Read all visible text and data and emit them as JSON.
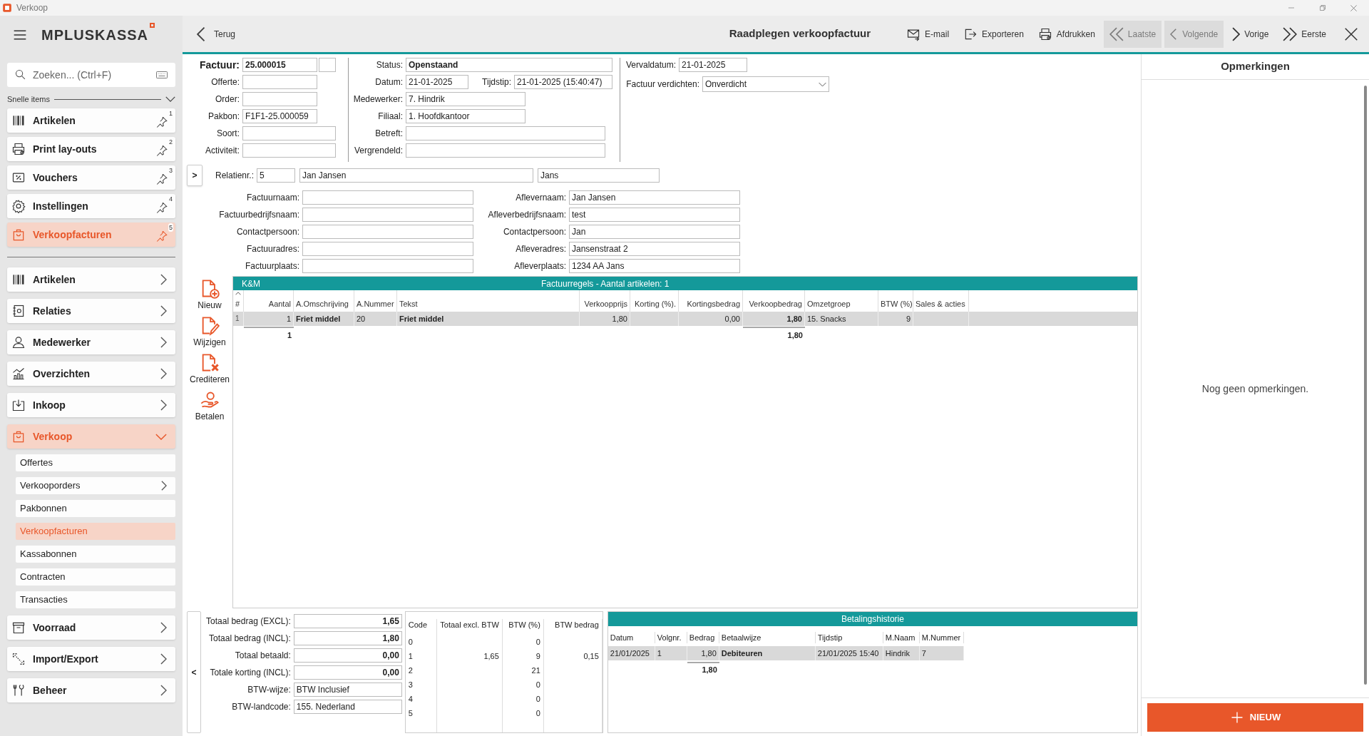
{
  "window": {
    "title": "Verkoop"
  },
  "app": {
    "logo": "MPLUSKASSA"
  },
  "search": {
    "placeholder": "Zoeken... (Ctrl+F)"
  },
  "quick_items": {
    "label": "Snelle items",
    "expanded": true,
    "items": [
      {
        "label": "Artikelen",
        "pin": "1",
        "selected": false
      },
      {
        "label": "Print lay-outs",
        "pin": "2",
        "selected": false
      },
      {
        "label": "Vouchers",
        "pin": "3",
        "selected": false
      },
      {
        "label": "Instellingen",
        "pin": "4",
        "selected": false
      },
      {
        "label": "Verkoopfacturen",
        "pin": "5",
        "selected": true
      }
    ]
  },
  "nav": [
    {
      "label": "Artikelen",
      "expanded": false,
      "selected": false
    },
    {
      "label": "Relaties",
      "expanded": false,
      "selected": false
    },
    {
      "label": "Medewerker",
      "expanded": false,
      "selected": false
    },
    {
      "label": "Overzichten",
      "expanded": false,
      "selected": false
    },
    {
      "label": "Inkoop",
      "expanded": false,
      "selected": false
    },
    {
      "label": "Verkoop",
      "expanded": true,
      "selected": true,
      "children": [
        {
          "label": "Offertes",
          "expandable": false,
          "selected": false
        },
        {
          "label": "Verkooporders",
          "expandable": true,
          "selected": false
        },
        {
          "label": "Pakbonnen",
          "expandable": false,
          "selected": false
        },
        {
          "label": "Verkoopfacturen",
          "expandable": false,
          "selected": true
        },
        {
          "label": "Kassabonnen",
          "expandable": false,
          "selected": false
        },
        {
          "label": "Contracten",
          "expandable": false,
          "selected": false
        },
        {
          "label": "Transacties",
          "expandable": false,
          "selected": false
        }
      ]
    },
    {
      "label": "Voorraad",
      "expanded": false,
      "selected": false
    },
    {
      "label": "Import/Export",
      "expanded": false,
      "selected": false
    },
    {
      "label": "Beheer",
      "expanded": false,
      "selected": false
    }
  ],
  "header": {
    "back": "Terug",
    "title": "Raadplegen verkoopfactuur",
    "actions": [
      {
        "label": "E-mail",
        "disabled": false
      },
      {
        "label": "Exporteren",
        "disabled": false
      },
      {
        "label": "Afdrukken",
        "disabled": false
      },
      {
        "label": "Laatste",
        "disabled": true
      },
      {
        "label": "Volgende",
        "disabled": true
      },
      {
        "label": "Vorige",
        "disabled": false
      },
      {
        "label": "Eerste",
        "disabled": false
      }
    ]
  },
  "document": {
    "left": [
      {
        "label": "Factuur:",
        "value": "25.000015"
      },
      {
        "label": "Offerte:"
      },
      {
        "label": "Order:"
      },
      {
        "label": "Pakbon:",
        "value": "F1F1-25.000059"
      },
      {
        "label": "Soort:"
      },
      {
        "label": "Activiteit:"
      }
    ],
    "middle": [
      [
        {
          "label": "Status:",
          "value": "Openstaand"
        }
      ],
      [
        {
          "label": "Datum:",
          "value": "21-01-2025"
        },
        {
          "label": "Tijdstip:",
          "value": "21-01-2025 (15:40:47)"
        }
      ],
      [
        {
          "label": "Medewerker:",
          "value": "7. Hindrik"
        }
      ],
      [
        {
          "label": "Filiaal:",
          "value": "1. Hoofdkantoor"
        }
      ],
      [
        {
          "label": "Betreft:"
        }
      ],
      [
        {
          "label": "Vergrendeld:"
        }
      ]
    ],
    "due_date": {
      "label": "Vervaldatum:",
      "value": "21-01-2025"
    },
    "condense": {
      "label": "Factuur verdichten:",
      "value": "Onverdicht"
    }
  },
  "relation": {
    "toggle": ">",
    "label": "Relatienr.:",
    "number": "5",
    "name": "Jan Jansen",
    "field_3": "Jans"
  },
  "billing": [
    {
      "label": "Factuurnaam:"
    },
    {
      "label": "Factuurbedrijfsnaam:"
    },
    {
      "label": "Contactpersoon:"
    },
    {
      "label": "Factuuradres:"
    },
    {
      "label": "Factuurplaats:"
    }
  ],
  "delivery": [
    {
      "label": "Aflevernaam:",
      "value": "Jan Jansen"
    },
    {
      "label": "Afleverbedrijfsnaam:",
      "value": "test"
    },
    {
      "label": "Contactpersoon:",
      "value": "Jan"
    },
    {
      "label": "Afleveradres:",
      "value": "Jansenstraat 2"
    },
    {
      "label": "Afleverplaats:",
      "value": "1234 AA Jans"
    }
  ],
  "side_actions": [
    "Nieuw",
    "Wijzigen",
    "Crediteren",
    "Betalen"
  ],
  "invoice_lines": {
    "group": "K&M",
    "title": "Factuurregels - Aantal artikelen: 1",
    "columns": [
      "#",
      "Aantal",
      "A.Omschrijving",
      "A.Nummer",
      "Tekst",
      "Verkoopprijs",
      "Korting (%).",
      "Kortingsbedrag",
      "Verkoopbedrag",
      "Omzetgroep",
      "BTW (%)",
      "Sales & acties"
    ],
    "rows": [
      {
        "selected": true,
        "nr": "1",
        "aantal": "1",
        "omschrijving": "Friet middel",
        "nummer": "20",
        "tekst": "Friet middel",
        "prijs": "1,80",
        "kortingsbedrag": "0,00",
        "bedrag": "1,80",
        "omzetgroep": "15. Snacks",
        "btw": "9"
      }
    ],
    "totals": {
      "aantal": "1",
      "bedrag": "1,80"
    }
  },
  "collapse_toggle": "<",
  "totals": [
    {
      "kind": "amount",
      "label": "Totaal bedrag (EXCL):",
      "value": "1,65"
    },
    {
      "kind": "amount",
      "label": "Totaal bedrag (INCL):",
      "value": "1,80"
    },
    {
      "kind": "amount",
      "label": "Totaal betaald:",
      "value": "0,00"
    },
    {
      "kind": "amount",
      "label": "Totale korting (INCL):",
      "value": "0,00"
    },
    {
      "kind": "text",
      "label": "BTW-wijze:",
      "value": "BTW Inclusief"
    },
    {
      "kind": "text",
      "label": "BTW-landcode:",
      "value": "155. Nederland"
    }
  ],
  "vat": {
    "columns": [
      "Code",
      "Totaal excl. BTW",
      "BTW (%)",
      "BTW bedrag"
    ],
    "rows": [
      {
        "code": "0",
        "pct": "0"
      },
      {
        "code": "1",
        "excl": "1,65",
        "pct": "9",
        "amount": "0,15"
      },
      {
        "code": "2",
        "pct": "21"
      },
      {
        "code": "3",
        "pct": "0"
      },
      {
        "code": "4",
        "pct": "0"
      },
      {
        "code": "5",
        "pct": "0"
      }
    ]
  },
  "payments": {
    "title": "Betalingshistorie",
    "columns": [
      "Datum",
      "Volgnr.",
      "Bedrag",
      "Betaalwijze",
      "Tijdstip",
      "M.Naam",
      "M.Nummer"
    ],
    "rows": [
      {
        "selected": true,
        "datum": "21/01/2025",
        "volgnr": "1",
        "bedrag": "1,80",
        "wijze": "Debiteuren",
        "tijd": "21/01/2025 15:40",
        "naam": "Hindrik",
        "nummer": "7"
      }
    ],
    "totals": {
      "bedrag": "1,80"
    }
  },
  "remarks": {
    "title": "Opmerkingen",
    "empty_text": "Nog geen opmerkingen.",
    "button": "NIEUW"
  }
}
